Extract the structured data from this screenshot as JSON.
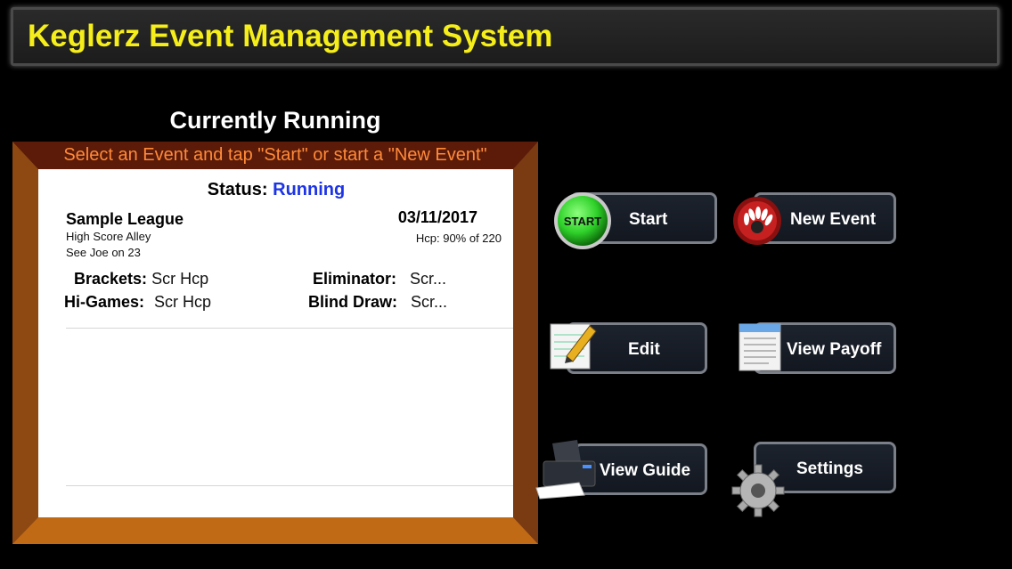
{
  "header": {
    "title": "Keglerz Event Management System"
  },
  "current": {
    "heading": "Currently Running",
    "instruction": "Select an Event and tap \"Start\" or start a \"New Event\"",
    "status_label": "Status:",
    "status_value": "Running",
    "event": {
      "name": "Sample League",
      "location": "High Score Alley",
      "note": "See Joe on 23",
      "date": "03/11/2017",
      "hcp": "Hcp: 90% of 220"
    },
    "rows": {
      "brackets_label": "Brackets:",
      "brackets_value": "Scr Hcp",
      "eliminator_label": "Eliminator:",
      "eliminator_value": "Scr...",
      "higames_label": "Hi-Games:",
      "higames_value": "Scr Hcp",
      "blinddraw_label": "Blind Draw:",
      "blinddraw_value": "Scr..."
    }
  },
  "buttons": {
    "start": {
      "label": "Start",
      "icon_text": "START",
      "icon": "start-ball-icon"
    },
    "new_event": {
      "label": "New Event",
      "icon": "bowling-pins-icon"
    },
    "edit": {
      "label": "Edit",
      "icon": "pencil-notepad-icon"
    },
    "view_payoff": {
      "label": "View Payoff",
      "icon": "document-icon"
    },
    "view_guide": {
      "label": "View Guide",
      "icon": "printer-icon"
    },
    "settings": {
      "label": "Settings",
      "icon": "gear-icon"
    }
  },
  "colors": {
    "title": "#f5ee1a",
    "status_running": "#1d34e6",
    "instruction": "#ff8a3a",
    "start_green": "#2fd12a"
  }
}
